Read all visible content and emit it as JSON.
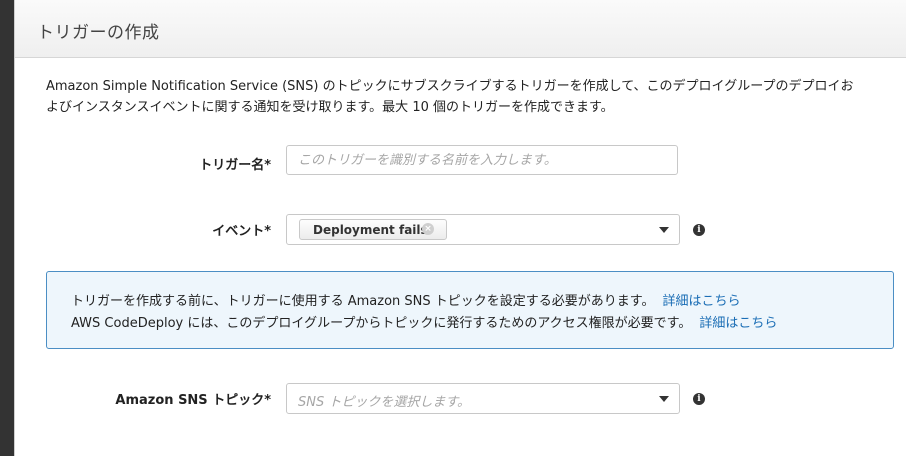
{
  "dialog": {
    "title": "トリガーの作成",
    "description_line1": "Amazon Simple Notification Service (SNS) のトピックにサブスクライブするトリガーを作成して、このデプロイグループのデプロイお",
    "description_line2": "よびインスタンスイベントに関する通知を受け取ります。最大 10 個のトリガーを作成できます。"
  },
  "form": {
    "trigger_name": {
      "label": "トリガー名*",
      "value": "",
      "placeholder": "このトリガーを識別する名前を入力します。"
    },
    "event": {
      "label": "イベント*",
      "selected_chip": "Deployment fails",
      "chip_remove_glyph": "×",
      "info_glyph": "i"
    },
    "sns_topic": {
      "label": "Amazon SNS トピック*",
      "placeholder": "SNS トピックを選択します。",
      "info_glyph": "i"
    }
  },
  "notice": {
    "line1_text": "トリガーを作成する前に、トリガーに使用する Amazon SNS トピックを設定する必要があります。",
    "line1_link": "詳細はこちら",
    "line2_text": "AWS CodeDeploy には、このデプロイグループからトピックに発行するためのアクセス権限が必要です。",
    "line2_link": "詳細はこちら",
    "border_color": "#4b8ec4",
    "background_color": "#eef6fc",
    "link_color": "#1a6db5"
  }
}
